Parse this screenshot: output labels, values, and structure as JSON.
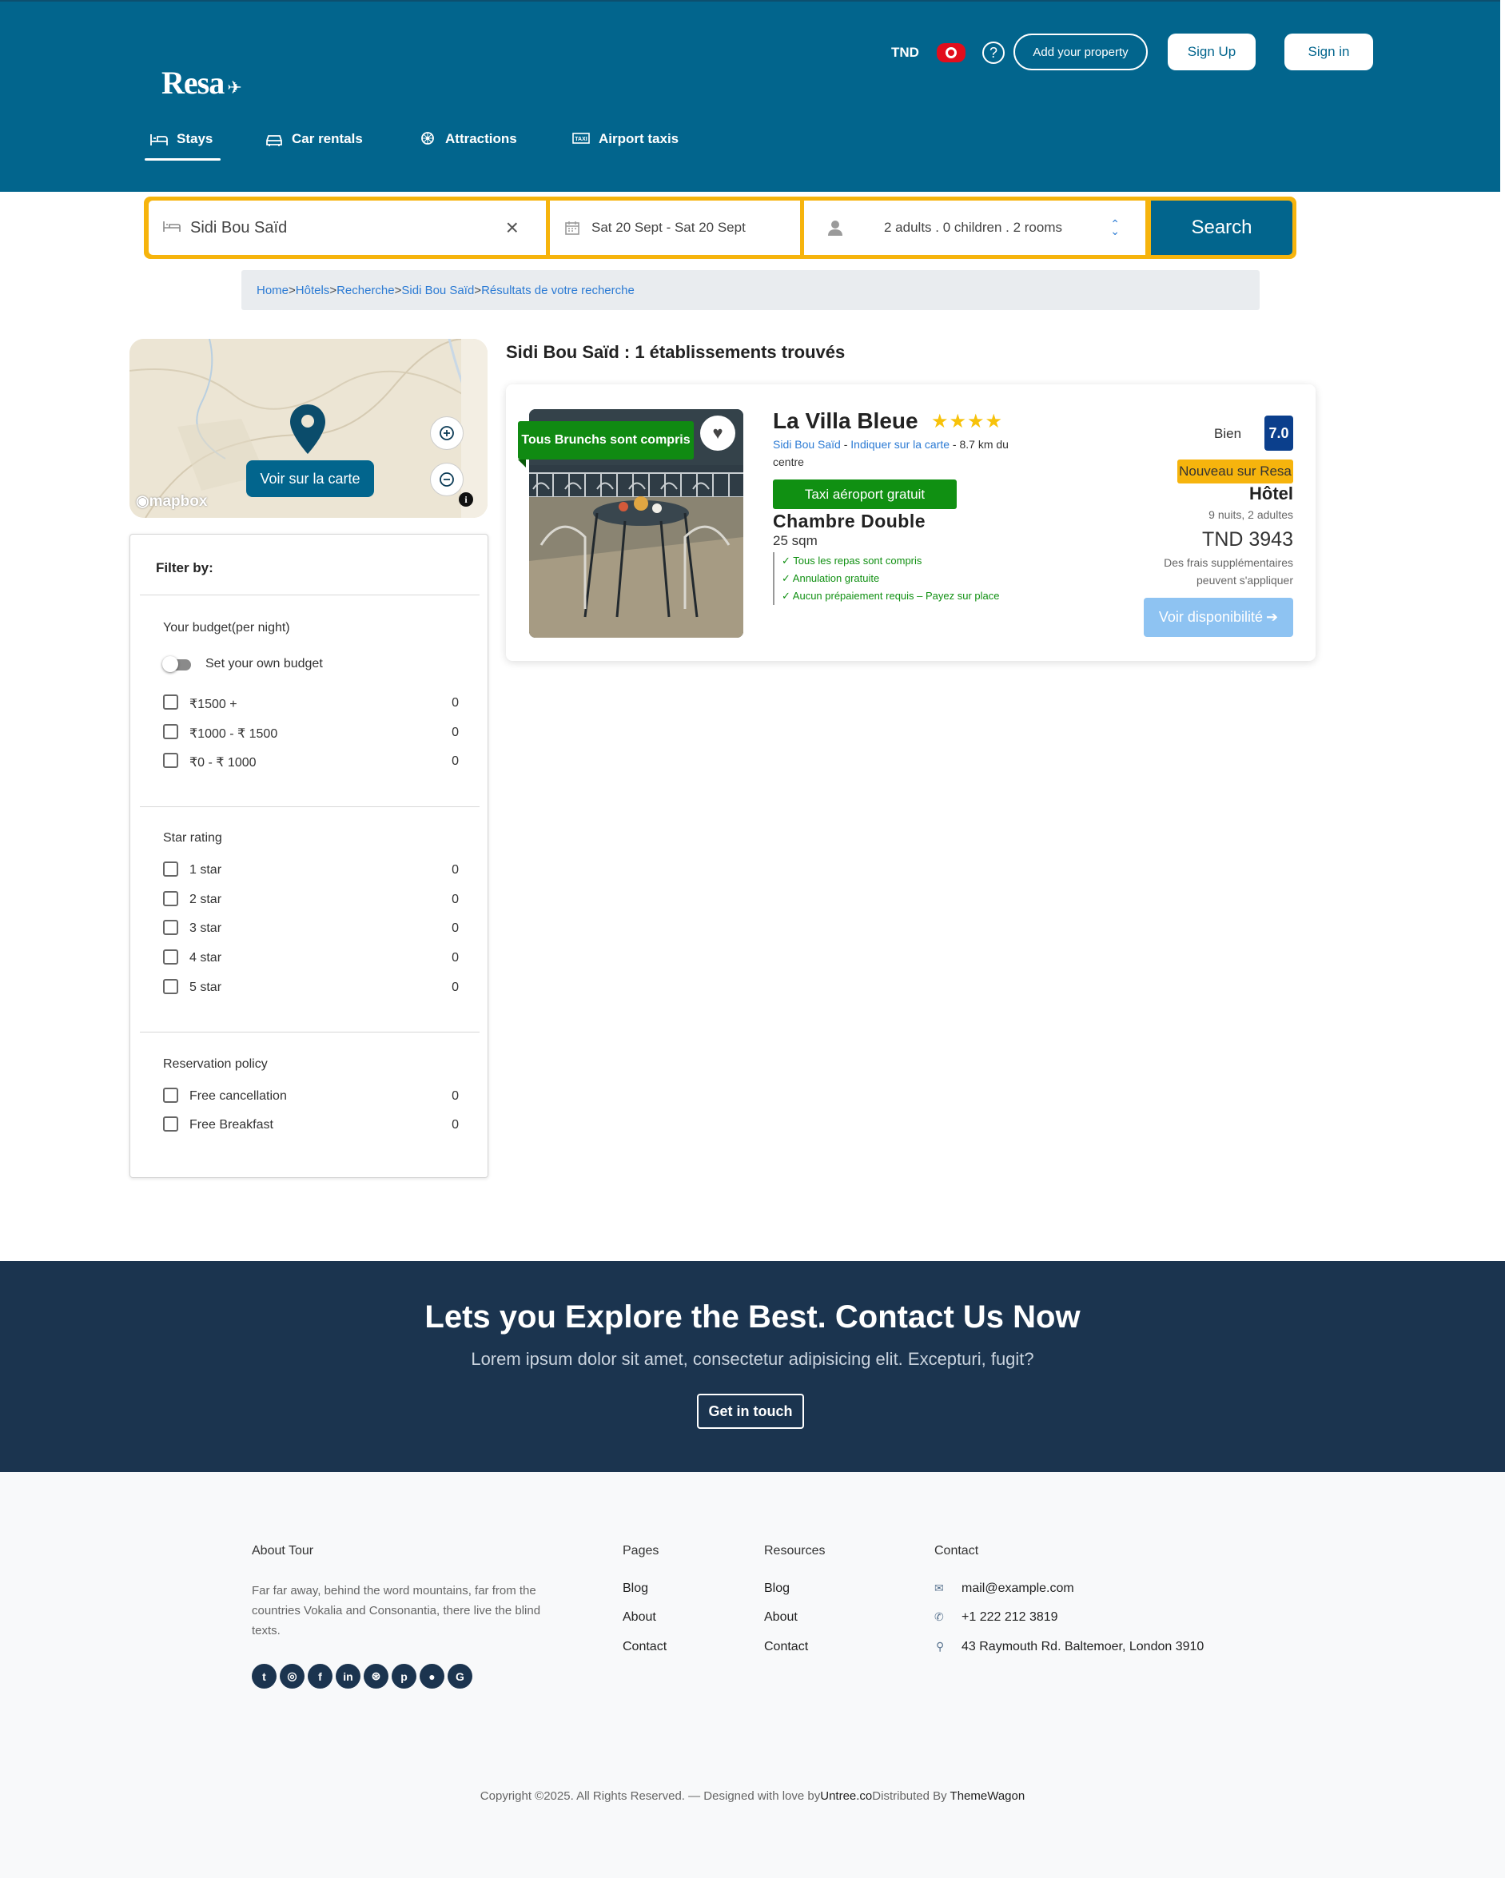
{
  "header": {
    "logo": "Resa",
    "currency": "TND",
    "add_property": "Add your property",
    "sign_up": "Sign Up",
    "sign_in": "Sign in",
    "nav": [
      {
        "label": "Stays",
        "icon": "bed-icon",
        "active": true
      },
      {
        "label": "Car rentals",
        "icon": "car-icon"
      },
      {
        "label": "Attractions",
        "icon": "attractions-icon"
      },
      {
        "label": "Airport taxis",
        "icon": "taxi-icon"
      }
    ]
  },
  "search": {
    "destination": "Sidi Bou Saïd",
    "dates": "Sat 20 Sept -  Sat 20 Sept",
    "guests": "2 adults .  0 children .  2 rooms",
    "button": "Search"
  },
  "breadcrumb": [
    "Home",
    "Hôtels",
    "Recherche",
    "Sidi Bou Saïd",
    "Résultats de votre recherche"
  ],
  "map": {
    "button": "Voir sur la carte",
    "attribution": "mapbox"
  },
  "filter": {
    "title": "Filter by:",
    "budget_heading": "Your budget(per night)",
    "budget_toggle": "Set your own budget",
    "budget_options": [
      {
        "label": "₹1500 +",
        "count": "0"
      },
      {
        "label": "₹1000 - ₹ 1500",
        "count": "0"
      },
      {
        "label": "₹0 - ₹ 1000",
        "count": "0"
      }
    ],
    "star_heading": "Star rating",
    "star_options": [
      {
        "label": "1 star",
        "count": "0"
      },
      {
        "label": "2 star",
        "count": "0"
      },
      {
        "label": "3 star",
        "count": "0"
      },
      {
        "label": "4 star",
        "count": "0"
      },
      {
        "label": "5 star",
        "count": "0"
      }
    ],
    "policy_heading": "Reservation policy",
    "policy_options": [
      {
        "label": "Free cancellation",
        "count": "0"
      },
      {
        "label": "Free Breakfast",
        "count": "0"
      }
    ]
  },
  "results": {
    "title": "Sidi Bou Saïd : 1 établissements trouvés",
    "hotel": {
      "promo": "Tous Brunchs sont compris",
      "name": "La Villa Bleue",
      "stars": "★★★★",
      "city": "Sidi Bou Saïd",
      "map_link": "Indiquer sur la carte",
      "distance": " - 8.7 km du centre",
      "taxi": "Taxi aéroport gratuit",
      "room": "Chambre Double",
      "size": "25 sqm",
      "perks": [
        "✓ Tous les repas sont compris",
        "✓ Annulation gratuite",
        "✓ Aucun prépaiement requis – Payez sur place"
      ],
      "rating_word": "Bien",
      "rating": "7.0",
      "badge": "Nouveau sur Resa",
      "type": "Hôtel",
      "nights": "9 nuits, 2 adultes",
      "price": "TND 3943",
      "fees": "Des frais supplémentaires peuvent s'appliquer",
      "cta": "Voir disponibilité"
    }
  },
  "contact_band": {
    "title": "Lets you Explore the Best. Contact Us Now",
    "subtitle": "Lorem ipsum dolor sit amet, consectetur adipisicing elit. Excepturi, fugit?",
    "button": "Get in touch"
  },
  "footer": {
    "about_heading": "About Tour",
    "about_text": "Far far away, behind the word mountains, far from the countries Vokalia and Consonantia, there live the blind texts.",
    "socials": [
      "twitter",
      "instagram",
      "facebook",
      "linkedin",
      "dribbble",
      "pinterest",
      "apple",
      "google"
    ],
    "pages_heading": "Pages",
    "pages": [
      "Blog",
      "About",
      "Contact"
    ],
    "resources_heading": "Resources",
    "resources": [
      "Blog",
      "About",
      "Contact"
    ],
    "contact_heading": "Contact",
    "email": "mail@example.com",
    "phone": "+1 222 212 3819",
    "address": "43 Raymouth Rd. Baltemoer, London 3910",
    "copyright": "Copyright ©2025. All Rights Reserved. — Designed with love by",
    "designer": "Untree.co",
    "distributed": "Distributed By ",
    "distributor": "ThemeWagon"
  },
  "colors": {
    "brand": "#02658d",
    "accent": "#f6b40d",
    "dark": "#1b344f",
    "green": "#109012"
  }
}
